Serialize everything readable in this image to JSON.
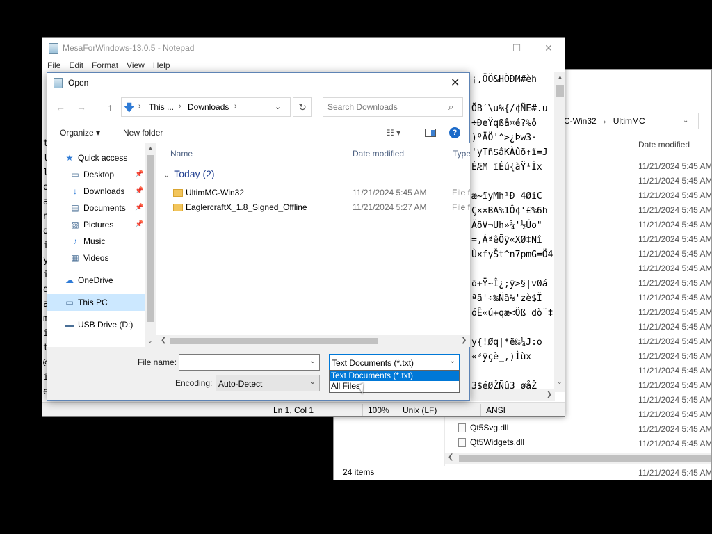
{
  "explorer": {
    "address": [
      "C-Win32",
      "UltimMC"
    ],
    "column_date": "Date modified",
    "dates": [
      "11/21/2024 5:45 AM",
      "11/21/2024 5:45 AM",
      "11/21/2024 5:45 AM",
      "11/21/2024 5:45 AM",
      "11/21/2024 5:45 AM",
      "11/21/2024 5:45 AM",
      "11/21/2024 5:45 AM",
      "11/21/2024 5:45 AM",
      "11/21/2024 5:45 AM",
      "11/21/2024 5:45 AM",
      "11/21/2024 5:45 AM",
      "11/21/2024 5:45 AM",
      "11/21/2024 5:45 AM",
      "11/21/2024 5:45 AM",
      "11/21/2024 5:45 AM",
      "11/21/2024 5:45 AM",
      "11/21/2024 5:45 AM",
      "11/21/2024 5:45 AM",
      "11/21/2024 5:45 AM",
      "11/21/2024 5:45 AM",
      "11/21/2024 5:45 AM",
      "11/21/2024 5:45 AM",
      "11/21/2024 5:45 AM",
      "11/21/2024 5:45 AM"
    ],
    "files_visible": [
      "Qt5Svg.dll",
      "Qt5Widgets.dll"
    ],
    "status": "24 items"
  },
  "notepad": {
    "title": "MesaForWindows-13.0.5 - Notepad",
    "menu": [
      "File",
      "Edit",
      "Format",
      "View",
      "Help"
    ],
    "minimize": "—",
    "maximize": "☐",
    "close": "✕",
    "text_lines": [
      "¡‚ÖÖ&HÒÐM#èh",
      "",
      "ÕB´\\u%{/¢ÑE#.u",
      "÷ÐeŸqßâ¤é?%ô",
      ")ºÄÖ'^>¿Þw3·",
      "'yTñ$âKÀûõ↑ï=J",
      "ÉÆM ïÉú{àŸ¹Ïx",
      "",
      "æ~ïyMh¹Ð 4ØiC",
      "Ç××BA%1Ô¢'£%6h",
      "ÃõV¬Uh»¾'½Úo\"",
      "=,ÁªêÕÿ«XØ‡Nî",
      "Ù×fyŠt^n7pmG=Ö4",
      "",
      "õ+Ÿ~Î¿;ÿ>§|v0á",
      "ªã'÷‰Ñã%'zè$Ï",
      "óÊ«ú+qæ<Öß dò¨‡N",
      "",
      "y{!Øq|*ë‰¼J:o",
      "«³ÿçè_,)Ìùx",
      "",
      "3$éØŽÑû3    øåŽ"
    ],
    "left_chars": [
      "t",
      "l",
      "l",
      "o",
      "a",
      "n",
      "d",
      "i",
      "y",
      "i",
      "d",
      "a",
      "m",
      "i",
      "t",
      "@",
      "i",
      "e",
      "o",
      "f"
    ],
    "status": {
      "position": "Ln 1, Col 1",
      "zoom": "100%",
      "line_ending": "Unix (LF)",
      "encoding": "ANSI"
    }
  },
  "dialog": {
    "title": "Open",
    "close": "✕",
    "nav": {
      "back": "←",
      "forward": "→",
      "up": "↑",
      "refresh": "↻"
    },
    "breadcrumb": [
      "This ...",
      "Downloads"
    ],
    "search_placeholder": "Search Downloads",
    "toolbar": {
      "organize": "Organize ▾",
      "new_folder": "New folder",
      "help": "?"
    },
    "sidebar": [
      {
        "label": "Quick access",
        "icon": "★",
        "pinned": false,
        "selected": false
      },
      {
        "label": "Desktop",
        "icon": "▭",
        "pinned": true,
        "selected": false
      },
      {
        "label": "Downloads",
        "icon": "↓",
        "pinned": true,
        "selected": false
      },
      {
        "label": "Documents",
        "icon": "▤",
        "pinned": true,
        "selected": false
      },
      {
        "label": "Pictures",
        "icon": "▨",
        "pinned": true,
        "selected": false
      },
      {
        "label": "Music",
        "icon": "♪",
        "pinned": false,
        "selected": false
      },
      {
        "label": "Videos",
        "icon": "▦",
        "pinned": false,
        "selected": false
      },
      {
        "label": "OneDrive",
        "icon": "☁",
        "pinned": false,
        "selected": false
      },
      {
        "label": "This PC",
        "icon": "▭",
        "pinned": false,
        "selected": true
      },
      {
        "label": "USB Drive (D:)",
        "icon": "▬",
        "pinned": false,
        "selected": false
      }
    ],
    "columns": {
      "name": "Name",
      "date": "Date modified",
      "type": "Type"
    },
    "group": "Today (2)",
    "files": [
      {
        "name": "UltimMC-Win32",
        "date": "11/21/2024 5:45 AM",
        "type": "File fo"
      },
      {
        "name": "EaglercraftX_1.8_Signed_Offline",
        "date": "11/21/2024 5:27 AM",
        "type": "File fo"
      }
    ],
    "file_name_label": "File name:",
    "file_name_value": "",
    "file_type_selected": "Text Documents (*.txt)",
    "file_type_options": [
      "Text Documents (*.txt)",
      "All Files"
    ],
    "encoding_label": "Encoding:",
    "encoding_value": "Auto-Detect"
  }
}
